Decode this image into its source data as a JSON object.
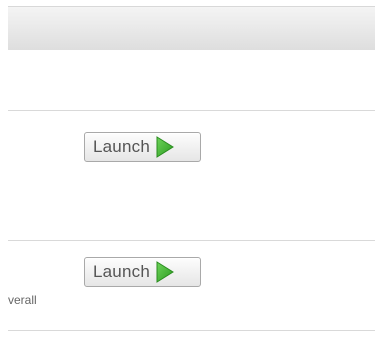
{
  "rows": [
    {
      "button_label": "Launch",
      "description": ""
    },
    {
      "button_label": "Launch",
      "description": "verall"
    }
  ],
  "icons": {
    "launch": "play-triangle-icon"
  },
  "colors": {
    "play_green": "#3cb02d",
    "divider": "#d9d9d9"
  }
}
